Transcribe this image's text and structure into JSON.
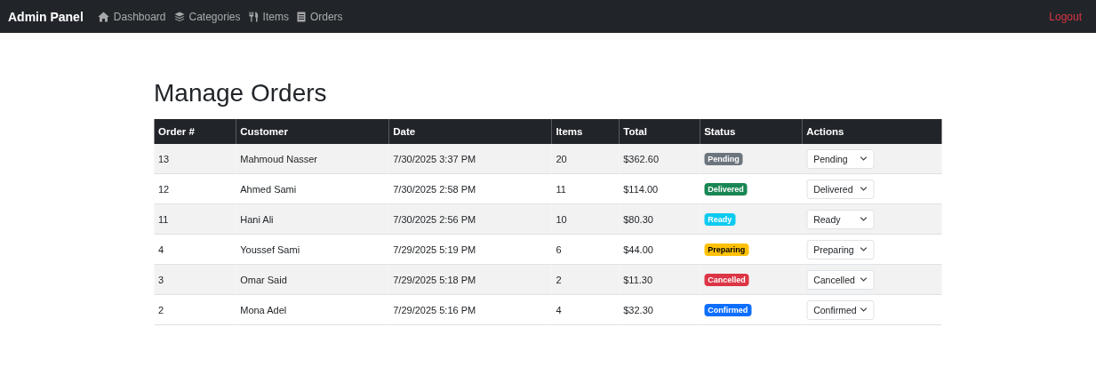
{
  "navbar": {
    "brand": "Admin Panel",
    "links": [
      {
        "label": "Dashboard"
      },
      {
        "label": "Categories"
      },
      {
        "label": "Items"
      },
      {
        "label": "Orders"
      }
    ],
    "logout": "Logout"
  },
  "page_title": "Manage Orders",
  "table": {
    "columns": [
      "Order #",
      "Customer",
      "Date",
      "Items",
      "Total",
      "Status",
      "Actions"
    ],
    "rows": [
      {
        "order": "13",
        "customer": "Mahmoud Nasser",
        "date": "7/30/2025 3:37 PM",
        "items": "20",
        "total": "$362.60",
        "status": {
          "label": "Pending",
          "color": "#6c757d"
        },
        "action": "Pending"
      },
      {
        "order": "12",
        "customer": "Ahmed Sami",
        "date": "7/30/2025 2:58 PM",
        "items": "11",
        "total": "$114.00",
        "status": {
          "label": "Delivered",
          "color": "#198754"
        },
        "action": "Delivered"
      },
      {
        "order": "11",
        "customer": "Hani Ali",
        "date": "7/30/2025 2:56 PM",
        "items": "10",
        "total": "$80.30",
        "status": {
          "label": "Ready",
          "color": "#0dcaf0"
        },
        "action": "Ready"
      },
      {
        "order": "4",
        "customer": "Youssef Sami",
        "date": "7/29/2025 5:19 PM",
        "items": "6",
        "total": "$44.00",
        "status": {
          "label": "Preparing",
          "color": "#ffc107"
        },
        "action": "Preparing"
      },
      {
        "order": "3",
        "customer": "Omar Said",
        "date": "7/29/2025 5:18 PM",
        "items": "2",
        "total": "$11.30",
        "status": {
          "label": "Cancelled",
          "color": "#dc3545"
        },
        "action": "Cancelled"
      },
      {
        "order": "2",
        "customer": "Mona Adel",
        "date": "7/29/2025 5:16 PM",
        "items": "4",
        "total": "$32.30",
        "status": {
          "label": "Confirmed",
          "color": "#0d6efd"
        },
        "action": "Confirmed"
      }
    ]
  }
}
